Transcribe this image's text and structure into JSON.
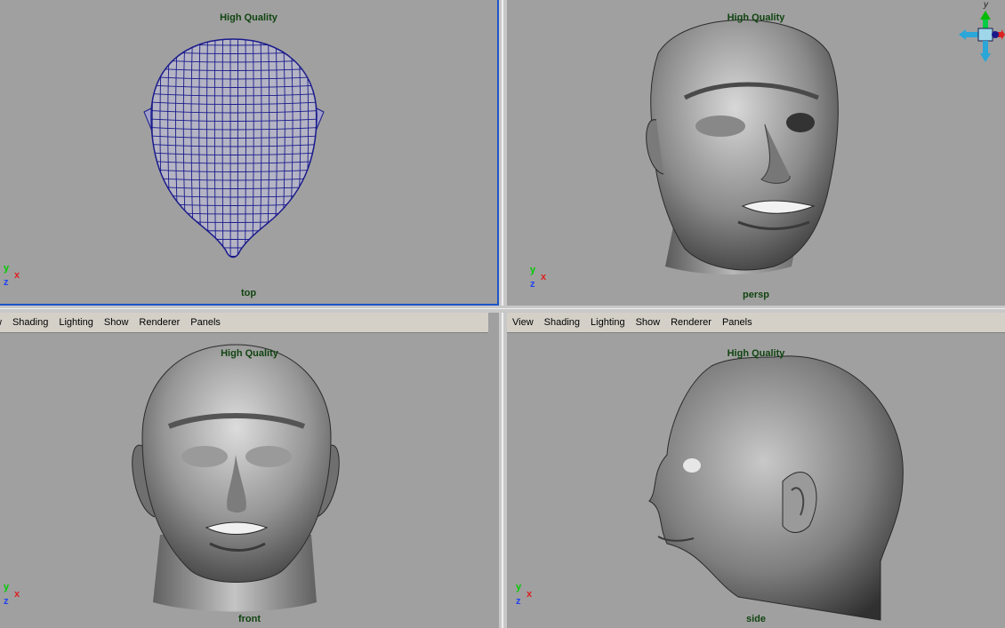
{
  "menu": [
    "View",
    "Shading",
    "Lighting",
    "Show",
    "Renderer",
    "Panels"
  ],
  "menu_front": [
    "w",
    "Shading",
    "Lighting",
    "Show",
    "Renderer",
    "Panels"
  ],
  "viewports": {
    "top": {
      "quality": "High Quality",
      "camera": "top"
    },
    "persp": {
      "quality": "High Quality",
      "camera": "persp"
    },
    "front": {
      "quality": "High Quality",
      "camera": "front"
    },
    "side": {
      "quality": "High Quality",
      "camera": "side"
    }
  },
  "axis": {
    "x": "x",
    "y": "y",
    "z": "z"
  },
  "viewcube": {
    "y_label": "y"
  },
  "colors": {
    "active_border": "#1f55c6",
    "viewport_bg": "#a0a0a0",
    "wire": "#1a1a8c",
    "label": "#114411"
  }
}
